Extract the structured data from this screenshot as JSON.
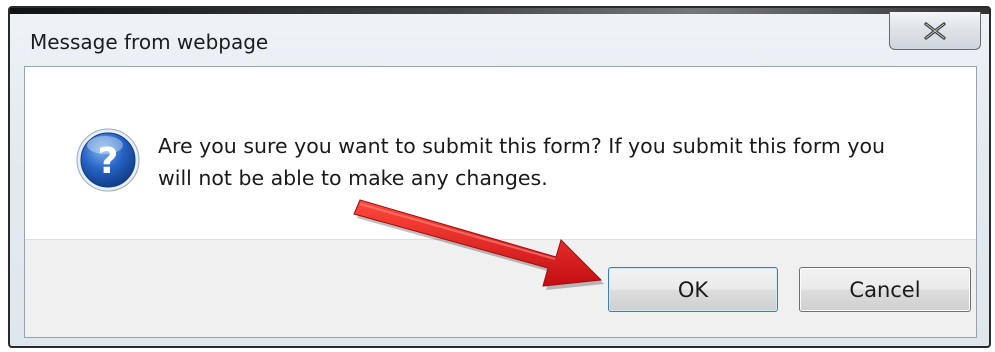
{
  "dialog": {
    "title": "Message from webpage",
    "close_label": "x",
    "message_line1": "Are you sure you want to submit this form?  If you submit this form you",
    "message_line2": "will not be able to make any changes.",
    "icon": "question-icon"
  },
  "buttons": {
    "ok_label": "OK",
    "cancel_label": "Cancel"
  },
  "annotation": {
    "arrow_color": "#e8191d",
    "points_to": "ok-button"
  },
  "colors": {
    "icon_blue": "#1f5fb8",
    "button_bar": "#f0f0f0"
  }
}
